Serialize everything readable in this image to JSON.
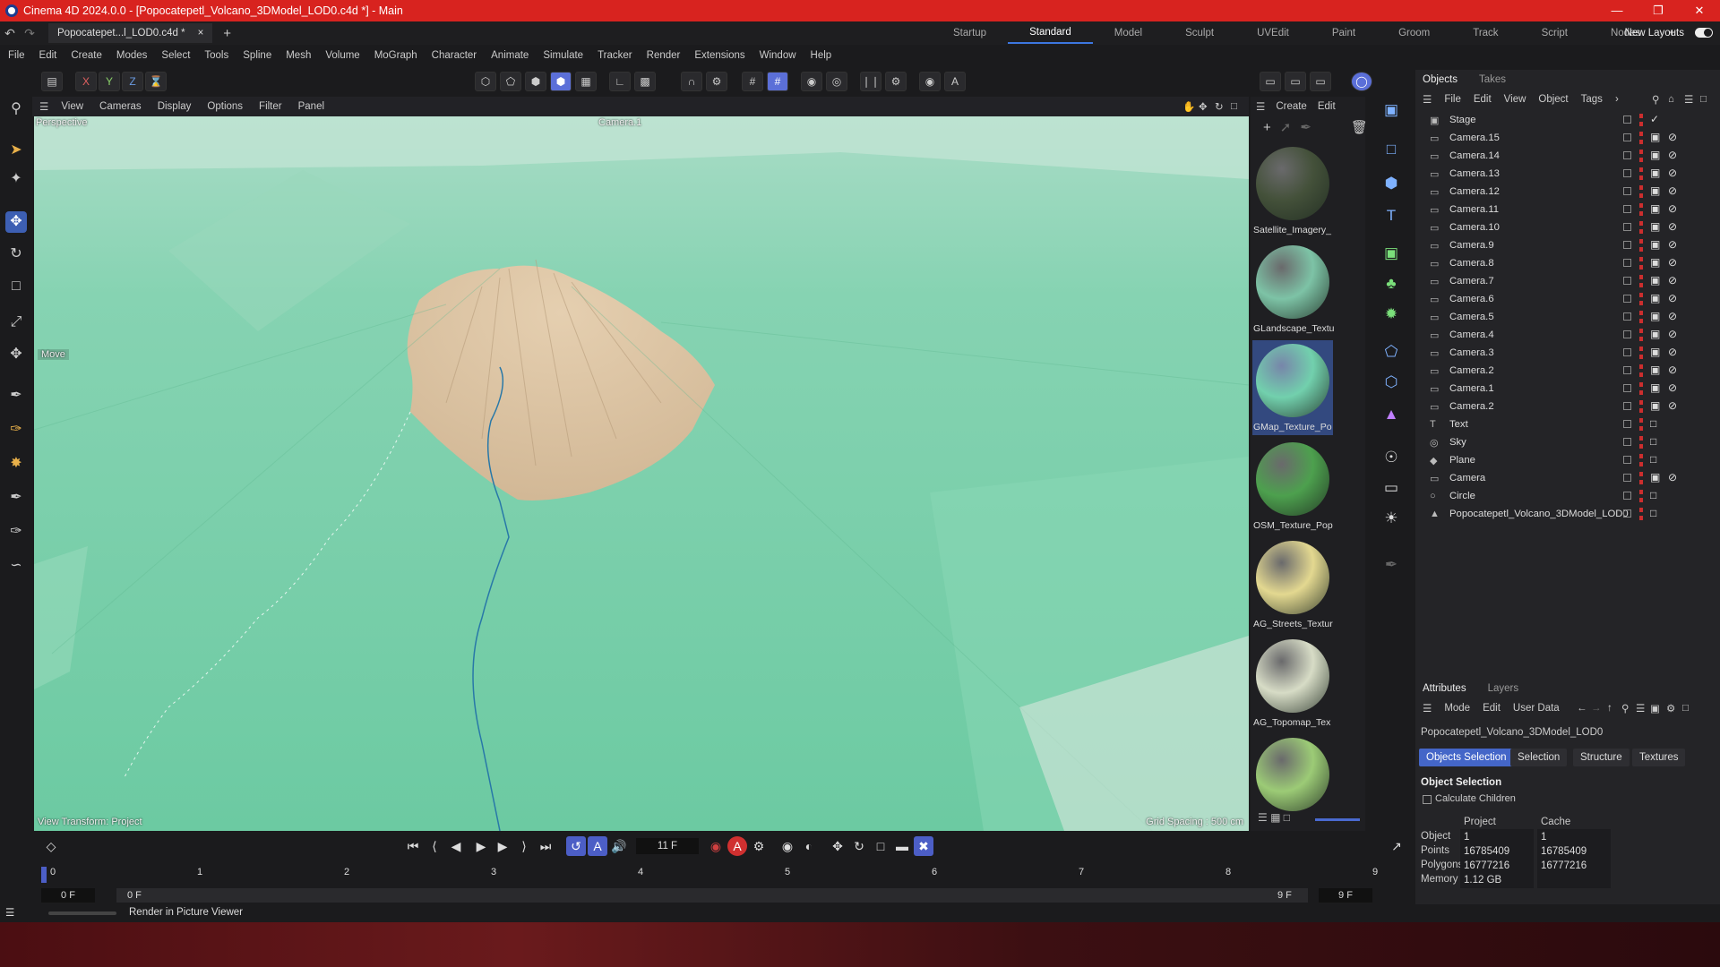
{
  "window": {
    "title": "Cinema 4D 2024.0.0 - [Popocatepetl_Volcano_3DModel_LOD0.c4d *] - Main"
  },
  "doc_tab": {
    "label": "Popocatepet...l_LOD0.c4d *",
    "close": "×"
  },
  "layouts": [
    "Startup",
    "Standard",
    "Model",
    "Sculpt",
    "UVEdit",
    "Paint",
    "Groom",
    "Track",
    "Script",
    "Nodes"
  ],
  "active_layout": "Standard",
  "new_layouts": "New Layouts",
  "menu": [
    "File",
    "Edit",
    "Create",
    "Modes",
    "Select",
    "Tools",
    "Spline",
    "Mesh",
    "Volume",
    "MoGraph",
    "Character",
    "Animate",
    "Simulate",
    "Tracker",
    "Render",
    "Extensions",
    "Window",
    "Help"
  ],
  "axis_buttons": [
    "X",
    "Y",
    "Z"
  ],
  "viewport": {
    "menu": [
      "View",
      "Cameras",
      "Display",
      "Options",
      "Filter",
      "Panel"
    ],
    "perspective": "Perspective",
    "camera": "Camera.1",
    "move_label": "Move",
    "view_transform": "View Transform: Project",
    "grid_spacing": "Grid Spacing : 500 cm"
  },
  "materials": {
    "menu": [
      "Create",
      "Edit"
    ],
    "items": [
      {
        "name": "Satellite_Imagery_",
        "color": "#44513a"
      },
      {
        "name": "GLandscape_Textu",
        "color": "#7dc3a6"
      },
      {
        "name": "GMap_Texture_Po",
        "color": "#72d0ad"
      },
      {
        "name": "OSM_Texture_Pop",
        "color": "#4da04e"
      },
      {
        "name": "AG_Streets_Textur",
        "color": "#e3d890"
      },
      {
        "name": "AG_Topomap_Tex",
        "color": "#d7dcc6"
      },
      {
        "name": "",
        "color": "#9ccb76"
      }
    ]
  },
  "objects": {
    "tabs": [
      "Objects",
      "Takes"
    ],
    "menu": [
      "File",
      "Edit",
      "View",
      "Object",
      "Tags"
    ],
    "items": [
      {
        "name": "Stage",
        "icon": "stage-icon"
      },
      {
        "name": "Camera.15",
        "icon": "camera-icon"
      },
      {
        "name": "Camera.14",
        "icon": "camera-icon"
      },
      {
        "name": "Camera.13",
        "icon": "camera-icon"
      },
      {
        "name": "Camera.12",
        "icon": "camera-icon"
      },
      {
        "name": "Camera.11",
        "icon": "camera-icon"
      },
      {
        "name": "Camera.10",
        "icon": "camera-icon"
      },
      {
        "name": "Camera.9",
        "icon": "camera-icon"
      },
      {
        "name": "Camera.8",
        "icon": "camera-icon"
      },
      {
        "name": "Camera.7",
        "icon": "camera-icon"
      },
      {
        "name": "Camera.6",
        "icon": "camera-icon"
      },
      {
        "name": "Camera.5",
        "icon": "camera-icon"
      },
      {
        "name": "Camera.4",
        "icon": "camera-icon"
      },
      {
        "name": "Camera.3",
        "icon": "camera-icon"
      },
      {
        "name": "Camera.2",
        "icon": "camera-icon"
      },
      {
        "name": "Camera.1",
        "icon": "camera-icon"
      },
      {
        "name": "Camera.2",
        "icon": "camera-icon"
      },
      {
        "name": "Text",
        "icon": "text-icon"
      },
      {
        "name": "Sky",
        "icon": "sky-icon"
      },
      {
        "name": "Plane",
        "icon": "plane-icon"
      },
      {
        "name": "Camera",
        "icon": "camera-icon"
      },
      {
        "name": "Circle",
        "icon": "circle-icon"
      },
      {
        "name": "Popocatepetl_Volcano_3DModel_LOD0",
        "icon": "polygon-icon"
      }
    ]
  },
  "attributes": {
    "tabs": [
      "Attributes",
      "Layers"
    ],
    "menu": [
      "Mode",
      "Edit",
      "User Data"
    ],
    "object_name": "Popocatepetl_Volcano_3DModel_LOD0",
    "buttons": [
      "Objects Selection",
      "Selection",
      "Structure",
      "Textures"
    ],
    "section": "Object Selection",
    "calculate_children": "Calculate Children",
    "col_project": "Project",
    "col_cache": "Cache",
    "rows": [
      {
        "label": "Object",
        "project": "1",
        "cache": "1"
      },
      {
        "label": "Points",
        "project": "16785409",
        "cache": "16785409"
      },
      {
        "label": "Polygons",
        "project": "16777216",
        "cache": "16777216"
      },
      {
        "label": "Memory",
        "project": "1.12 GB",
        "cache": ""
      }
    ]
  },
  "timeline": {
    "frame": "11 F",
    "ticks": [
      "0",
      "1",
      "2",
      "3",
      "4",
      "5",
      "6",
      "7",
      "8",
      "9"
    ],
    "start_a": "0 F",
    "start_b": "0 F",
    "end_a": "9 F",
    "end_b": "9 F"
  },
  "status": {
    "text": "Render in Picture Viewer"
  }
}
